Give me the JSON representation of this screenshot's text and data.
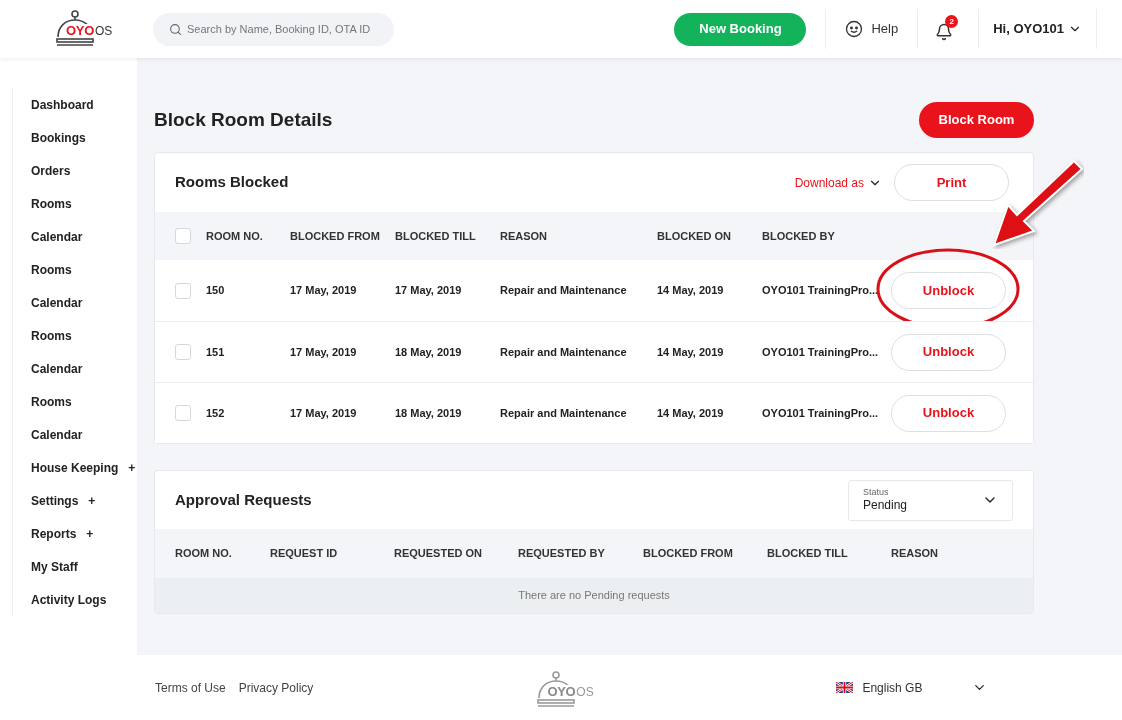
{
  "header": {
    "logo": {
      "brand": "OYO",
      "suffix": "OS"
    },
    "search": {
      "placeholder": "Search by Name, Booking ID, OTA ID"
    },
    "new_booking": "New Booking",
    "help": "Help",
    "notifications": {
      "count": "2"
    },
    "user": "Hi, OYO101"
  },
  "sidebar": {
    "items": [
      {
        "label": "Dashboard"
      },
      {
        "label": "Bookings"
      },
      {
        "label": "Orders"
      },
      {
        "label": "Rooms"
      },
      {
        "label": "Calendar"
      },
      {
        "label": "Rooms"
      },
      {
        "label": "Calendar"
      },
      {
        "label": "Rooms"
      },
      {
        "label": "Calendar"
      },
      {
        "label": "Rooms"
      },
      {
        "label": "Calendar"
      },
      {
        "label": "House Keeping",
        "toggle": "+"
      },
      {
        "label": "Settings",
        "toggle": "+"
      },
      {
        "label": "Reports",
        "toggle": "+"
      },
      {
        "label": "My Staff"
      },
      {
        "label": "Activity Logs"
      }
    ]
  },
  "page": {
    "title": "Block Room Details",
    "action": "Block Room"
  },
  "rooms_blocked": {
    "title": "Rooms Blocked",
    "download": "Download as",
    "print": "Print",
    "columns": [
      "ROOM NO.",
      "BLOCKED FROM",
      "BLOCKED TILL",
      "REASON",
      "BLOCKED ON",
      "BLOCKED BY"
    ],
    "select_all": {
      "checked": false
    },
    "rows": [
      {
        "checked": false,
        "highlighted": true,
        "cells": [
          "150",
          "17 May, 2019",
          "17 May, 2019",
          "Repair and Maintenance",
          "14 May, 2019",
          "OYO101 TrainingPro..."
        ],
        "action": "Unblock"
      },
      {
        "checked": false,
        "highlighted": false,
        "cells": [
          "151",
          "17 May, 2019",
          "18 May, 2019",
          "Repair and Maintenance",
          "14 May, 2019",
          "OYO101 TrainingPro..."
        ],
        "action": "Unblock"
      },
      {
        "checked": false,
        "highlighted": false,
        "cells": [
          "152",
          "17 May, 2019",
          "18 May, 2019",
          "Repair and Maintenance",
          "14 May, 2019",
          "OYO101 TrainingPro..."
        ],
        "action": "Unblock"
      }
    ]
  },
  "approval_requests": {
    "title": "Approval Requests",
    "status": {
      "label": "Status",
      "value": "Pending"
    },
    "columns": [
      "ROOM NO.",
      "REQUEST ID",
      "REQUESTED ON",
      "REQUESTED BY",
      "BLOCKED FROM",
      "BLOCKED TILL",
      "REASON"
    ],
    "empty_message": "There are no Pending requests"
  },
  "footer": {
    "links": [
      "Terms of Use",
      "Privacy Policy"
    ],
    "logo": {
      "brand": "OYO",
      "suffix": "OS"
    },
    "language": "English GB"
  }
}
